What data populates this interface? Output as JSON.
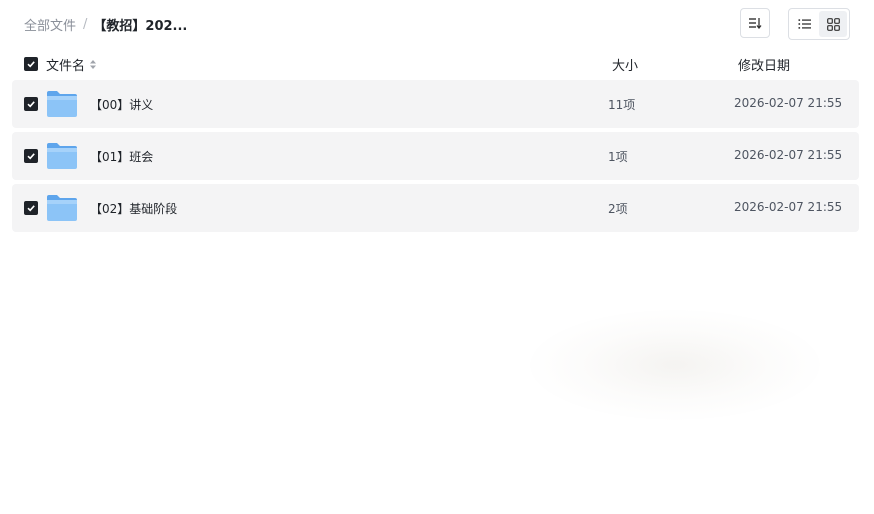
{
  "breadcrumb": {
    "root": "全部文件",
    "separator": "/",
    "current": "【教招】202..."
  },
  "toolbar": {
    "sort_icon": "sort-lines-icon",
    "list_view_icon": "list-view-icon",
    "grid_view_icon": "grid-view-icon"
  },
  "table": {
    "columns": {
      "name": "文件名",
      "size": "大小",
      "date": "修改日期"
    },
    "rows": [
      {
        "name": "【00】讲义",
        "count": "11项",
        "modified": "2026-02-07 21:55"
      },
      {
        "name": "【01】班会",
        "count": "1项",
        "modified": "2026-02-07 21:55"
      },
      {
        "name": "【02】基础阶段",
        "count": "2项",
        "modified": "2026-02-07 21:55"
      }
    ]
  },
  "colors": {
    "checkbox": "#1f2329",
    "row_bg": "#f4f4f5",
    "folder_blue": "#7db8f5",
    "text_primary": "#1f2329",
    "text_muted": "#8a8f99"
  }
}
